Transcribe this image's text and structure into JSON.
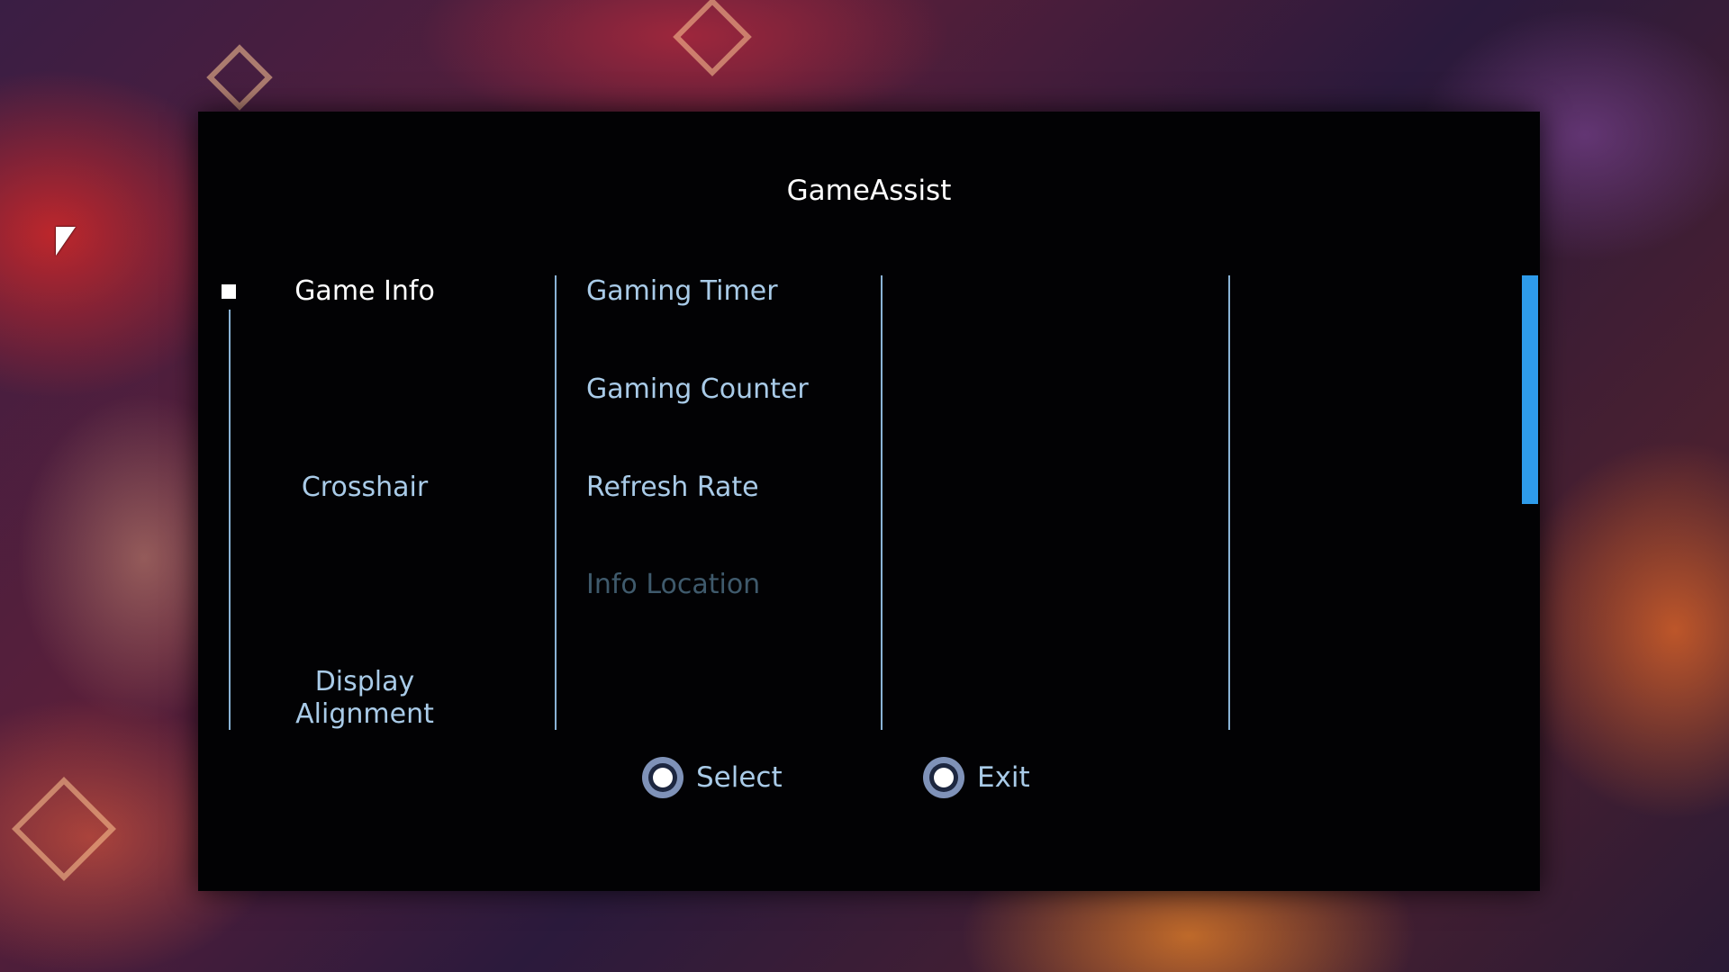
{
  "osd": {
    "title": "GameAssist",
    "nav_items": [
      {
        "label": "Game Info",
        "active": true
      },
      {
        "label": "Crosshair",
        "active": false
      },
      {
        "label": "Display\nAlignment",
        "active": false
      }
    ],
    "sub_items": [
      {
        "label": "Gaming Timer",
        "enabled": true
      },
      {
        "label": "Gaming Counter",
        "enabled": true
      },
      {
        "label": "Refresh Rate",
        "enabled": true
      },
      {
        "label": "Info Location",
        "enabled": false
      }
    ],
    "footer": {
      "select_label": "Select",
      "exit_label": "Exit",
      "select_icon": "joystick-press-icon",
      "exit_icon": "joystick-icon"
    },
    "colors": {
      "panel_bg": "#020204",
      "text_active": "#ffffff",
      "text_normal": "#a9cbe8",
      "text_disabled": "#3f5a6c",
      "divider": "#8ab3d6",
      "scrollbar": "#2e9bea"
    }
  }
}
